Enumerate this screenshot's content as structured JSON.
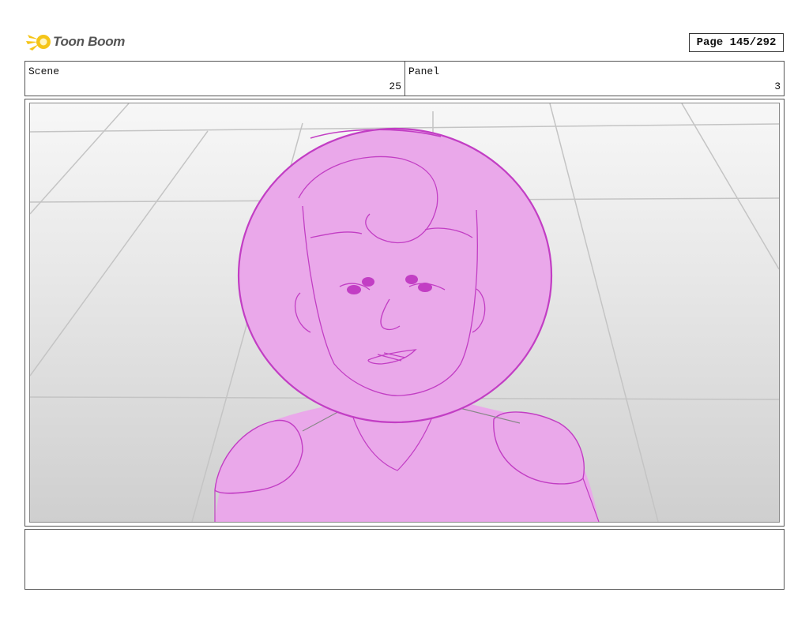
{
  "header": {
    "logo_text": "Toon Boom",
    "page_label": "Page 145/292"
  },
  "scene": {
    "label": "Scene",
    "value": "25"
  },
  "panel": {
    "label": "Panel",
    "value": "3"
  },
  "colors": {
    "sketch_fill": "#eaa8ea",
    "sketch_line": "#c23ec4",
    "logo_yellow": "#f5c518"
  },
  "icons": [
    "toon-boom-logo-icon"
  ],
  "notes": {
    "text": ""
  }
}
